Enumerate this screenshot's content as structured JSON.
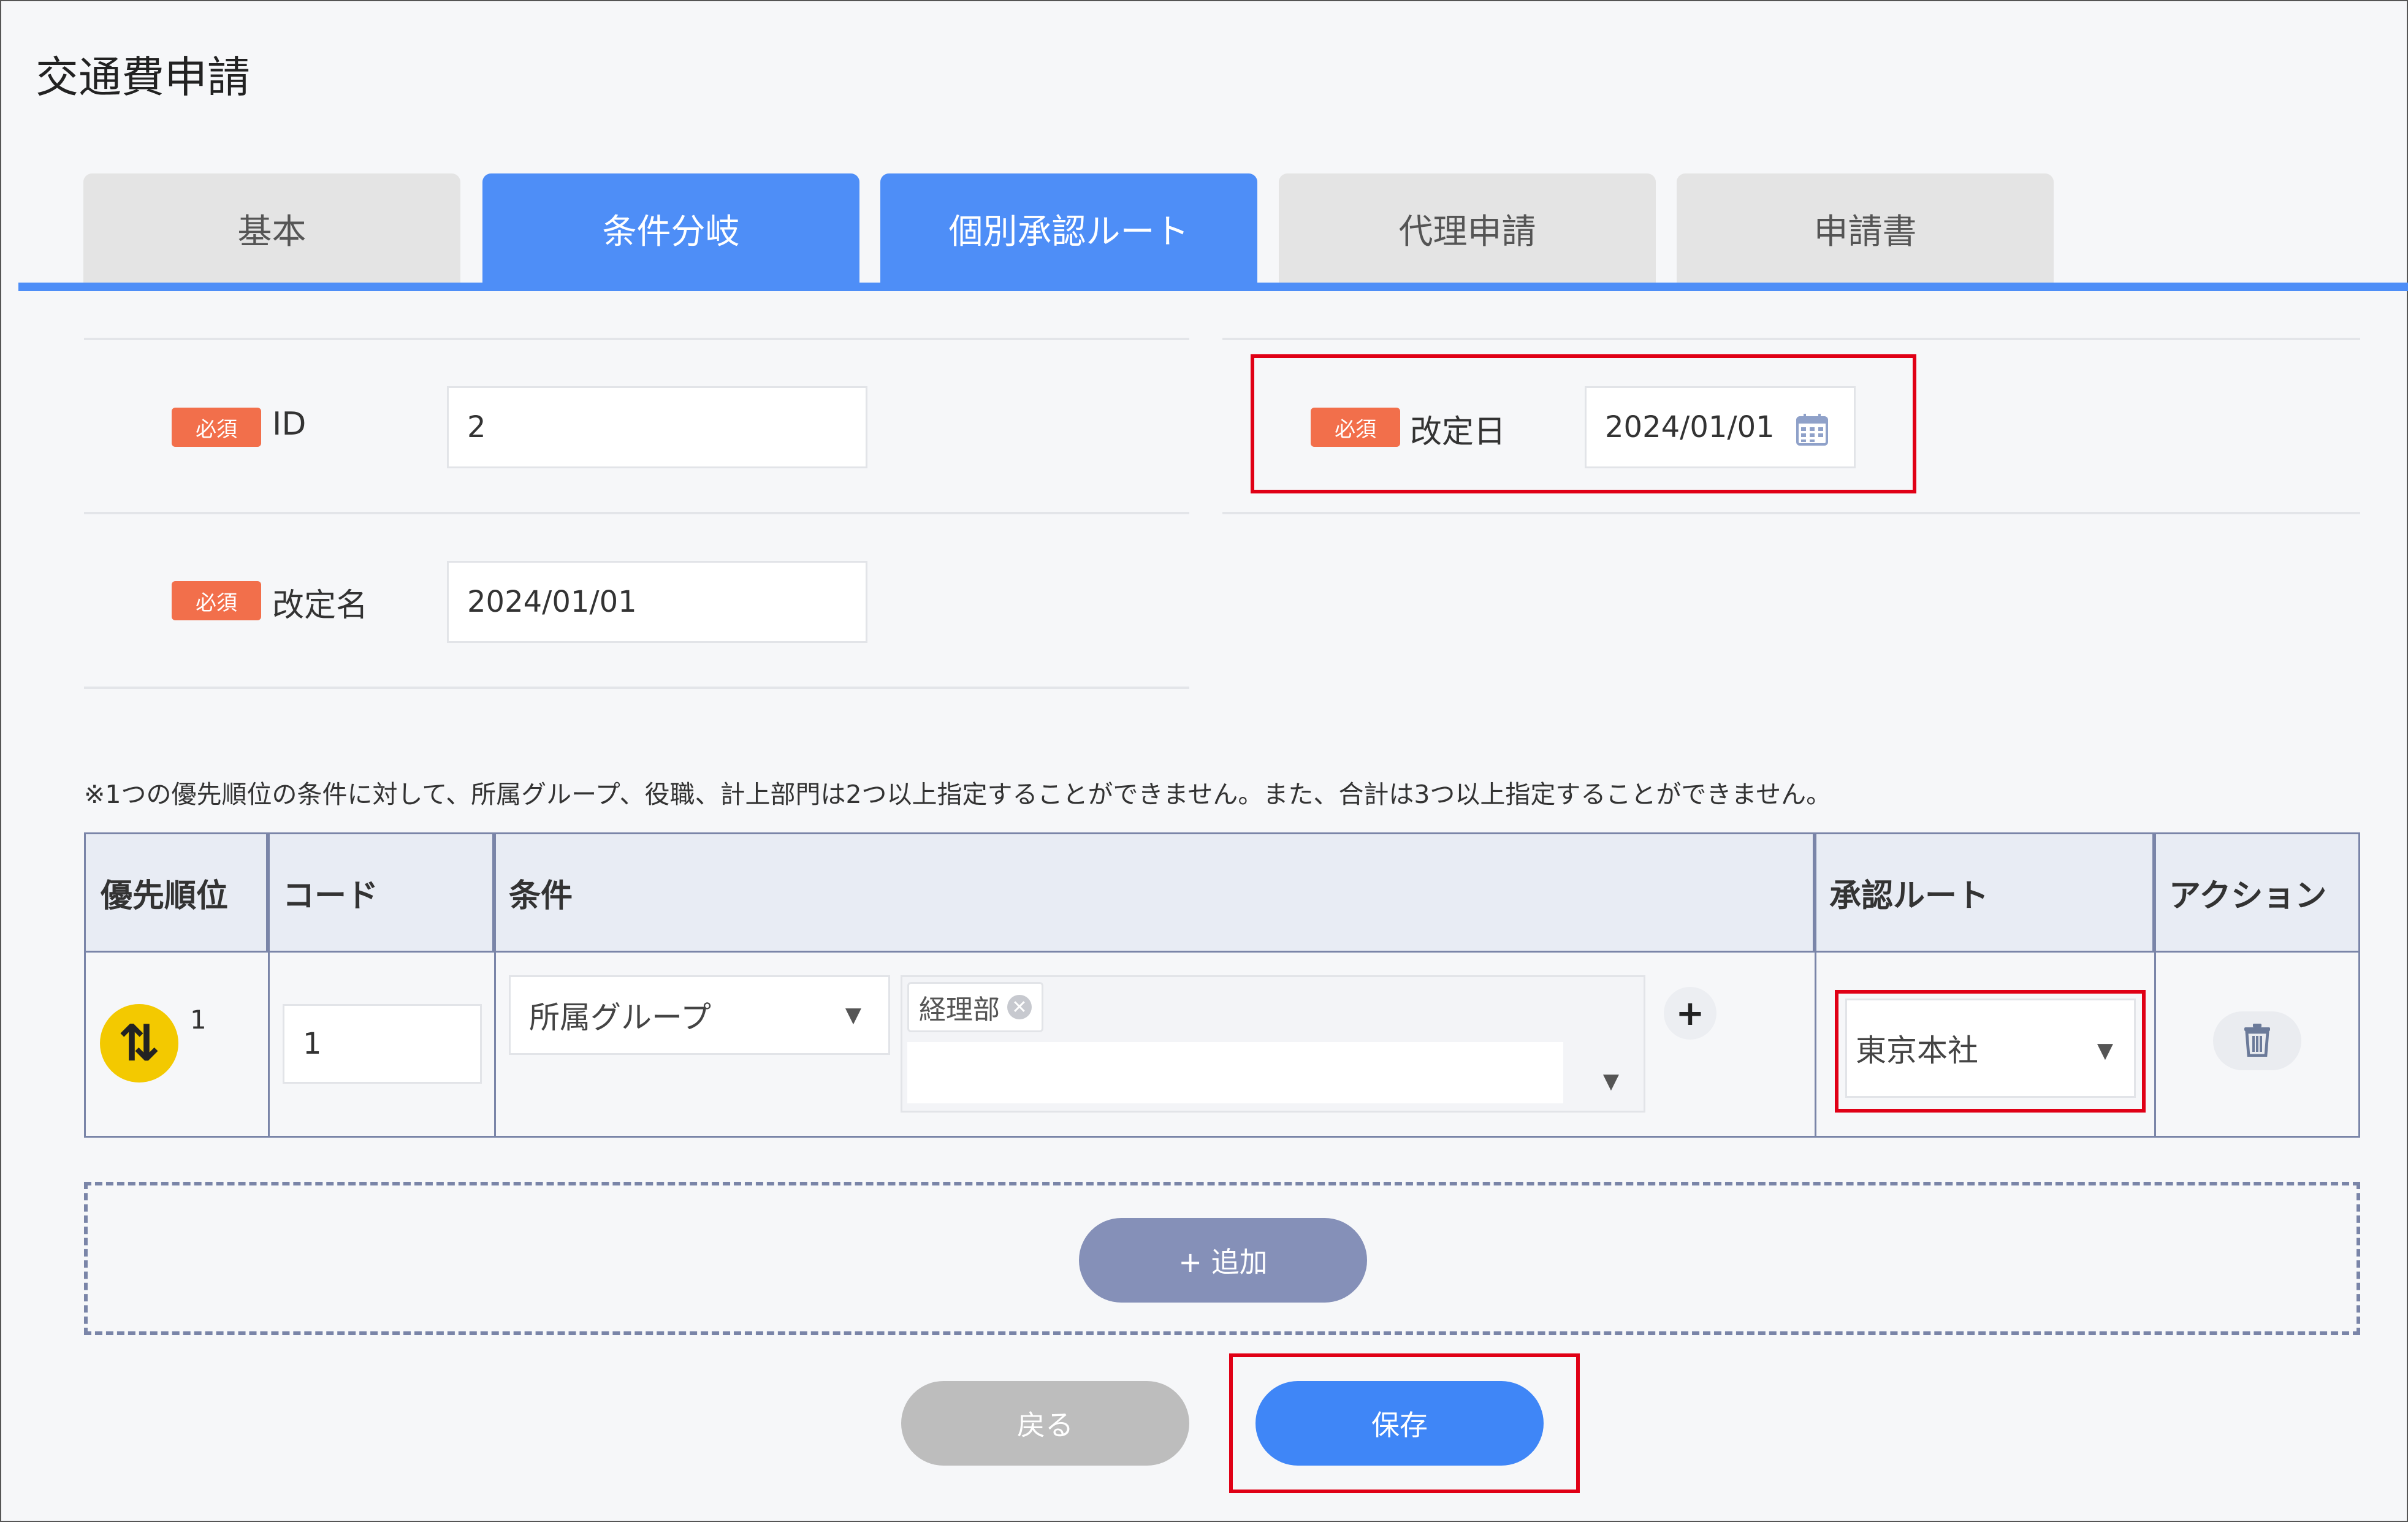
{
  "page": {
    "title": "交通費申請"
  },
  "tabs": [
    {
      "label": "基本",
      "active": false
    },
    {
      "label": "条件分岐",
      "active": true
    },
    {
      "label": "個別承認ルート",
      "active": true
    },
    {
      "label": "代理申請",
      "active": false
    },
    {
      "label": "申請書",
      "active": false
    }
  ],
  "form": {
    "required_badge": "必須",
    "id": {
      "label": "ID",
      "value": "2"
    },
    "revision_date": {
      "label": "改定日",
      "value": "2024/01/01",
      "icon": "calendar-icon"
    },
    "revision_name": {
      "label": "改定名",
      "value": "2024/01/01"
    }
  },
  "note": "※1つの優先順位の条件に対して、所属グループ、役職、計上部門は2つ以上指定することができません。また、合計は3つ以上指定することができません。",
  "table": {
    "headers": [
      "優先順位",
      "コード",
      "条件",
      "承認ルート",
      "アクション"
    ],
    "rows": [
      {
        "priority": "1",
        "code": "1",
        "condition_type": "所属グループ",
        "condition_tags": [
          "経理部"
        ],
        "approval_route": "東京本社"
      }
    ]
  },
  "buttons": {
    "add": "+ 追加",
    "back": "戻る",
    "save": "保存"
  },
  "colors": {
    "accent": "#4e8ef7",
    "required": "#f26f4b",
    "highlight": "#e00016",
    "priority_badge": "#f3c900"
  }
}
